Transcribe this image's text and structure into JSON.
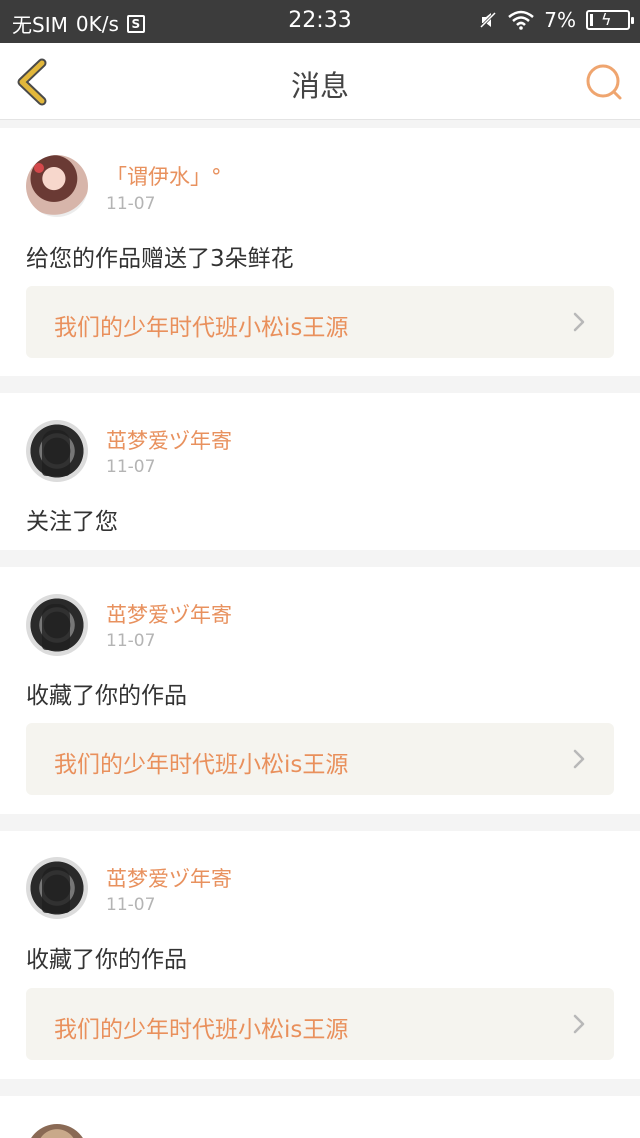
{
  "status_bar": {
    "carrier": "无SIM",
    "speed": "0K/s",
    "sim_icon_letter": "S",
    "time": "22:33",
    "battery_percent": "7%",
    "battery_level": 0.07,
    "icons": [
      "mute-icon",
      "wifi-icon",
      "battery-charging-icon"
    ]
  },
  "header": {
    "title": "消息",
    "back_icon": "chevron-left-icon",
    "search_icon": "search-icon",
    "accent_color": "#e9905c",
    "back_color": "#e0b43a"
  },
  "notifications": [
    {
      "user": "「谓伊水」°",
      "date": "11-07",
      "action": "给您的作品赠送了3朵鲜花",
      "work": "我们的少年时代班小松is王源"
    },
    {
      "user": "茁梦爱ヅ年寄",
      "date": "11-07",
      "action": "关注了您",
      "work": ""
    },
    {
      "user": "茁梦爱ヅ年寄",
      "date": "11-07",
      "action": "收藏了你的作品",
      "work": "我们的少年时代班小松is王源"
    },
    {
      "user": "茁梦爱ヅ年寄",
      "date": "11-07",
      "action": "收藏了你的作品",
      "work": "我们的少年时代班小松is王源"
    }
  ]
}
